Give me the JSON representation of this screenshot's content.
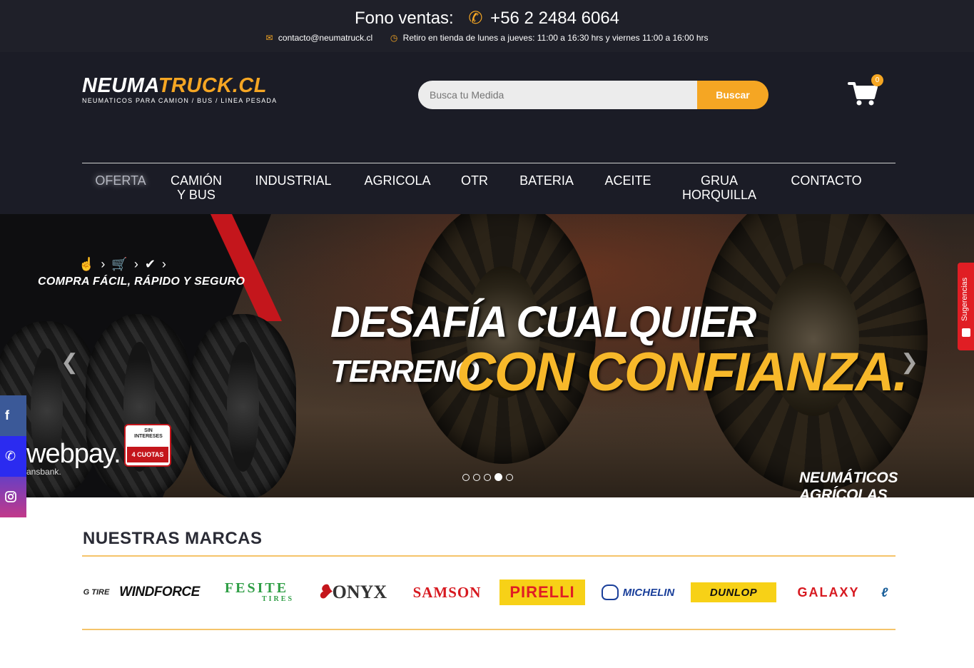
{
  "topbar": {
    "sales_label": "Fono ventas:",
    "phone": "+56 2 2484 6064",
    "email": "contacto@neumatruck.cl",
    "hours": "Retiro en tienda de lunes a jueves: 11:00 a 16:30 hrs y viernes 11:00 a 16:00 hrs"
  },
  "header": {
    "logo_main_white": "NEUMA",
    "logo_main_accent": "TRUCK",
    "logo_main_suffix": ".CL",
    "logo_sub": "NEUMATICOS PARA CAMION / BUS / LINEA PESADA",
    "search_placeholder": "Busca tu Medida",
    "search_button": "Buscar",
    "cart_count": "0"
  },
  "nav": {
    "items": [
      {
        "label": "OFERTA"
      },
      {
        "label": "CAMIÓN",
        "label2": "Y BUS"
      },
      {
        "label": "INDUSTRIAL"
      },
      {
        "label": "AGRICOLA"
      },
      {
        "label": "OTR"
      },
      {
        "label": "BATERIA"
      },
      {
        "label": "ACEITE"
      },
      {
        "label": "GRUA",
        "label2": "HORQUILLA"
      },
      {
        "label": "CONTACTO"
      }
    ]
  },
  "hero": {
    "steps_text": "COMPRA FÁCIL, RÁPIDO Y SEGURO",
    "headline_1": "DESAFÍA CUALQUIER",
    "headline_2": "TERRENO",
    "headline_3": "CON CONFIANZA.",
    "footer_tag": "NEUMÁTICOS AGRÍCOLAS",
    "webpay": "webpay.",
    "transbank": "ansbank.",
    "badge_sin": "SIN INTERESES",
    "badge_cuotas": "4 CUOTAS",
    "active_slide": 4,
    "slide_count": 5
  },
  "sugerencias": "Sugerencias",
  "brands": {
    "title": "NUESTRAS MARCAS",
    "items": {
      "gtire": "G TIRE",
      "windforce": "WINDFORCE",
      "fesite_a": "FESITE",
      "fesite_b": "TIRES",
      "onyx": "ONYX",
      "samson": "SAMSON",
      "pirelli": "PIRELLI",
      "michelin": "MICHELIN",
      "dunlop": "DUNLOP",
      "galaxy": "GALAXY"
    }
  },
  "colors": {
    "accent": "#f5a623",
    "topbar_bg": "#1f2029",
    "header_bg": "#1b1c26"
  }
}
